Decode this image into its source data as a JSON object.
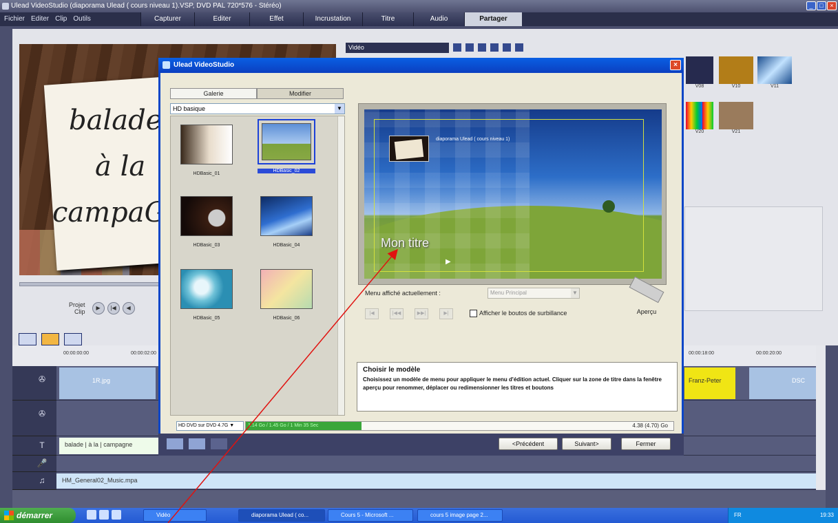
{
  "app": {
    "title": "Ulead VideoStudio (diaporama Ulead ( cours niveau 1).VSP, DVD PAL 720*576 - Stéréo)",
    "menus": [
      "Fichier",
      "Editer",
      "Clip",
      "Outils"
    ],
    "steps": [
      "Capturer",
      "Editer",
      "Effet",
      "Incrustation",
      "Titre",
      "Audio",
      "Partager"
    ],
    "active_step": "Partager"
  },
  "preview": {
    "handwriting": [
      "balade",
      "à la",
      "campaGne"
    ],
    "clip_label_top": "Projet",
    "clip_label_bottom": "Clip"
  },
  "library": {
    "category": "Vidéo",
    "thumbs": [
      "V08",
      "V10",
      "V11",
      "V20",
      "V21"
    ]
  },
  "timeline": {
    "ticks": [
      "00:00:00:00",
      "00:00:02:00",
      "00:00:18:00",
      "00:00:20:00"
    ],
    "video_clip": "1R.jpg",
    "video_clip_right": "Franz-Peter",
    "video_clip_far": "DSC",
    "title_clip": "balade | à la | campagne",
    "music_clip": "HM_General02_Music.mpa"
  },
  "dialog": {
    "title": "Ulead VideoStudio",
    "tabs": [
      "Galerie",
      "Modifier"
    ],
    "combo": "HD basique",
    "templates": [
      "HDBasic_01",
      "HDBasic_02",
      "HDBasic_03",
      "HDBasic_04",
      "HDBasic_05",
      "HDBasic_06"
    ],
    "selected_template": "HDBasic_02",
    "preview_subtitle": "diaporama Ulead ( cours niveau 1)",
    "preview_title": "Mon titre",
    "menu_label": "Menu affiché actuellement :",
    "menu_value": "Menu Principal",
    "nav_buttons": [
      "|◀",
      "|◀◀",
      "▶▶|",
      "▶|"
    ],
    "checkbox_label": "Afficher le boutos de surbillance",
    "apercu_label": "Aperçu",
    "help_title": "Choisir le modèle",
    "help_text": "Choisissez un modèle de menu pour appliquer le menu d'édition actuel. Cliquer sur la zone de titre dans la fenêtre aperçu pour renommer, déplacer ou redimensionner les titres et boutons",
    "disc_type": "HD DVD sur DVD 4.7G",
    "capacity_text": "1.14 Go / 1.45 Go / 1 Min 35 Sec",
    "capacity_fill_fraction": 0.27,
    "disc_size": "4.38 (4.70) Go",
    "buttons": {
      "prev": "<Précédent",
      "next": "Suivant>",
      "close": "Fermer"
    }
  },
  "taskbar": {
    "start": "démarrer",
    "tasks": [
      "Vidéo",
      "diaporama Ulead ( co...",
      "Cours 5 - Microsoft ...",
      "cours 5 image page 2..."
    ],
    "tray_lang": "FR",
    "clock": "19:33"
  },
  "colors": {
    "annotation_arrow": "#e0120f",
    "dialog_border": "#0a46c8",
    "active_tab": "#cfd3df"
  }
}
